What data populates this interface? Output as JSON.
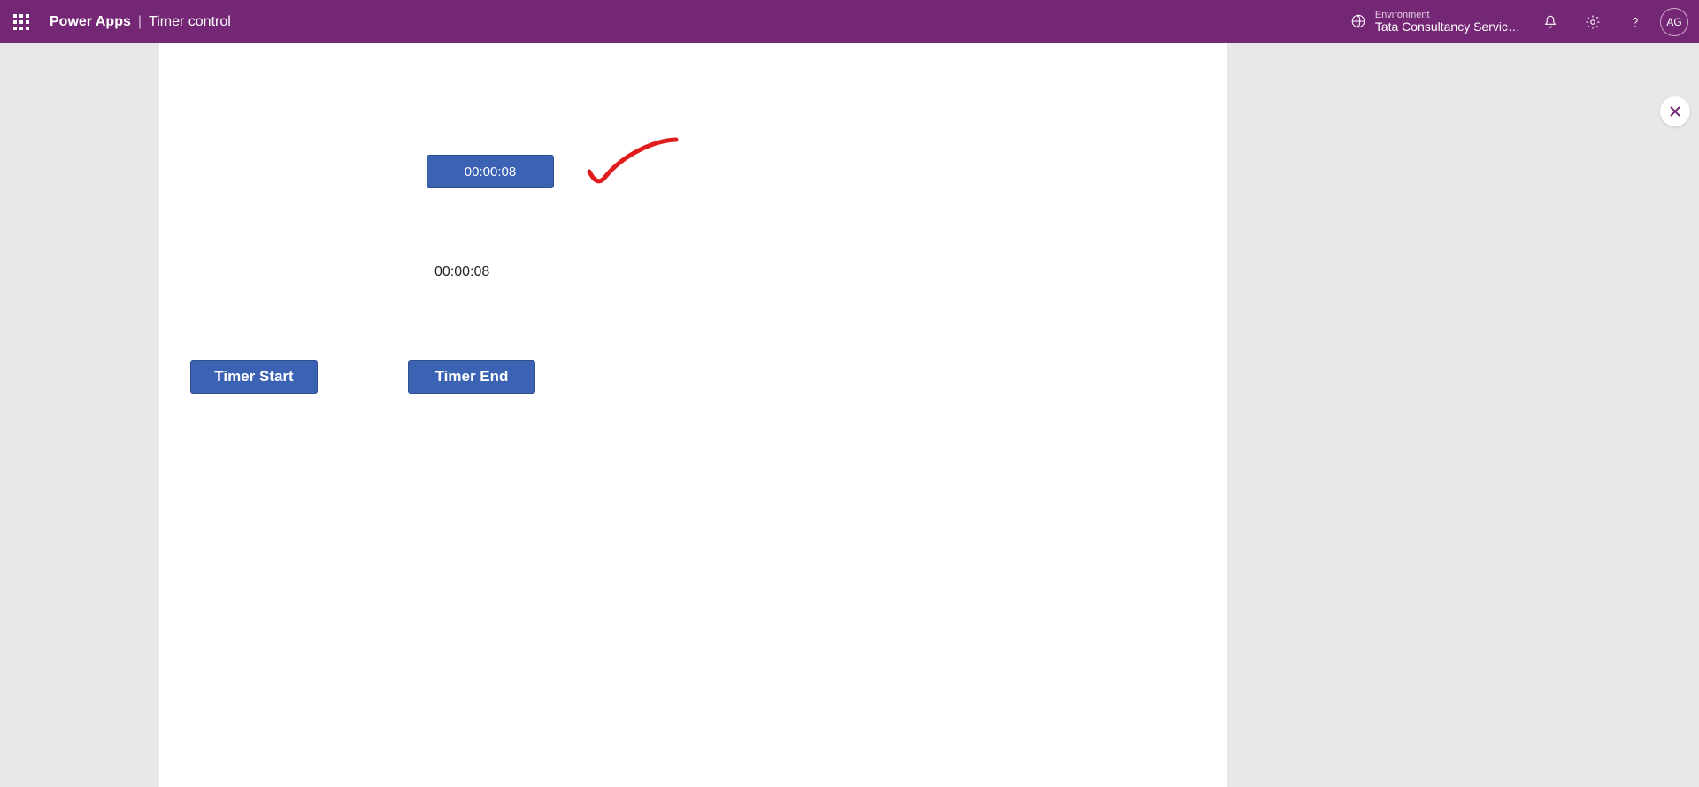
{
  "header": {
    "brand": "Power Apps",
    "separator": "|",
    "page_title": "Timer control",
    "environment_label": "Environment",
    "environment_name": "Tata Consultancy Servic…",
    "avatar_initials": "AG"
  },
  "canvas": {
    "timer_display": "00:00:08",
    "label_value": "00:00:08",
    "button_start": "Timer Start",
    "button_end": "Timer End"
  },
  "colors": {
    "brand_purple": "#742774",
    "button_blue": "#3b62b3",
    "annotation_red": "#e11c1c"
  }
}
